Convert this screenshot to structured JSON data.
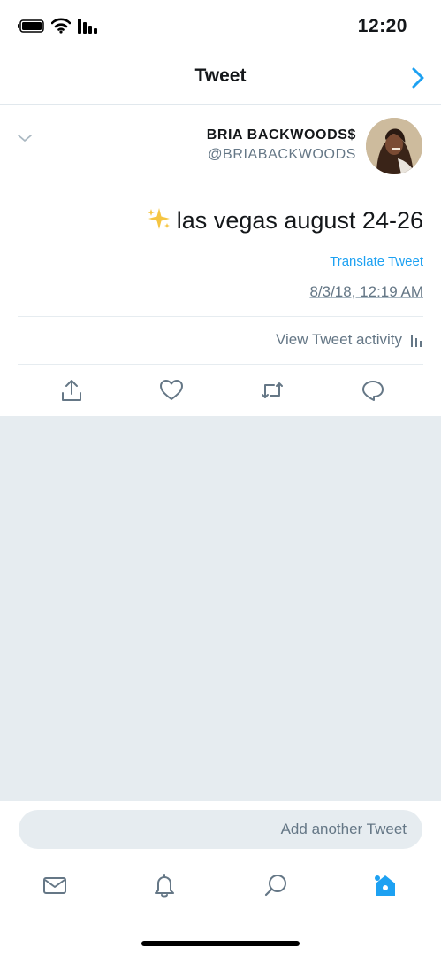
{
  "status_bar": {
    "time": "12:20"
  },
  "nav": {
    "title": "Tweet"
  },
  "tweet": {
    "author_name": "BRIA BACKWOODS$",
    "author_handle": "@BRIABACKWOODS",
    "text": "las vegas august 24-26",
    "emoji": "sparkles",
    "translate_label": "Translate Tweet",
    "timestamp": "8/3/18, 12:19 AM",
    "activity_label": "View Tweet activity"
  },
  "composer": {
    "placeholder": "Add another Tweet"
  },
  "icons": {
    "reply": "reply-icon",
    "retweet": "retweet-icon",
    "like": "heart-icon",
    "share": "share-icon"
  },
  "colors": {
    "accent": "#1da1f2",
    "muted": "#657786",
    "background_gray": "#e6ecf0"
  }
}
